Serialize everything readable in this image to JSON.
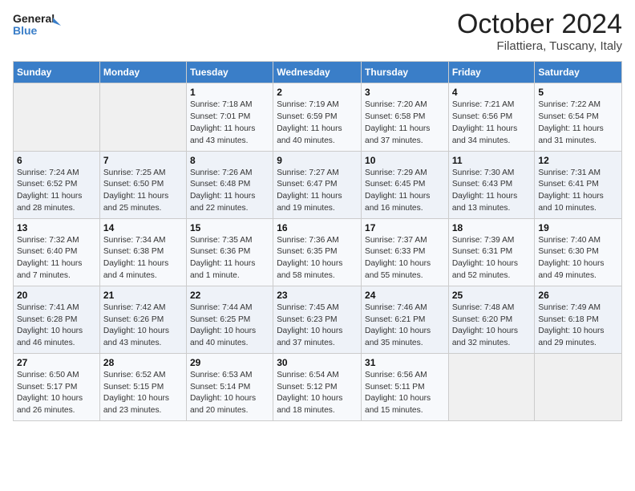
{
  "header": {
    "logo_line1": "General",
    "logo_line2": "Blue",
    "month": "October 2024",
    "location": "Filattiera, Tuscany, Italy"
  },
  "weekdays": [
    "Sunday",
    "Monday",
    "Tuesday",
    "Wednesday",
    "Thursday",
    "Friday",
    "Saturday"
  ],
  "weeks": [
    [
      {
        "num": "",
        "info": ""
      },
      {
        "num": "",
        "info": ""
      },
      {
        "num": "1",
        "info": "Sunrise: 7:18 AM\nSunset: 7:01 PM\nDaylight: 11 hours and 43 minutes."
      },
      {
        "num": "2",
        "info": "Sunrise: 7:19 AM\nSunset: 6:59 PM\nDaylight: 11 hours and 40 minutes."
      },
      {
        "num": "3",
        "info": "Sunrise: 7:20 AM\nSunset: 6:58 PM\nDaylight: 11 hours and 37 minutes."
      },
      {
        "num": "4",
        "info": "Sunrise: 7:21 AM\nSunset: 6:56 PM\nDaylight: 11 hours and 34 minutes."
      },
      {
        "num": "5",
        "info": "Sunrise: 7:22 AM\nSunset: 6:54 PM\nDaylight: 11 hours and 31 minutes."
      }
    ],
    [
      {
        "num": "6",
        "info": "Sunrise: 7:24 AM\nSunset: 6:52 PM\nDaylight: 11 hours and 28 minutes."
      },
      {
        "num": "7",
        "info": "Sunrise: 7:25 AM\nSunset: 6:50 PM\nDaylight: 11 hours and 25 minutes."
      },
      {
        "num": "8",
        "info": "Sunrise: 7:26 AM\nSunset: 6:48 PM\nDaylight: 11 hours and 22 minutes."
      },
      {
        "num": "9",
        "info": "Sunrise: 7:27 AM\nSunset: 6:47 PM\nDaylight: 11 hours and 19 minutes."
      },
      {
        "num": "10",
        "info": "Sunrise: 7:29 AM\nSunset: 6:45 PM\nDaylight: 11 hours and 16 minutes."
      },
      {
        "num": "11",
        "info": "Sunrise: 7:30 AM\nSunset: 6:43 PM\nDaylight: 11 hours and 13 minutes."
      },
      {
        "num": "12",
        "info": "Sunrise: 7:31 AM\nSunset: 6:41 PM\nDaylight: 11 hours and 10 minutes."
      }
    ],
    [
      {
        "num": "13",
        "info": "Sunrise: 7:32 AM\nSunset: 6:40 PM\nDaylight: 11 hours and 7 minutes."
      },
      {
        "num": "14",
        "info": "Sunrise: 7:34 AM\nSunset: 6:38 PM\nDaylight: 11 hours and 4 minutes."
      },
      {
        "num": "15",
        "info": "Sunrise: 7:35 AM\nSunset: 6:36 PM\nDaylight: 11 hours and 1 minute."
      },
      {
        "num": "16",
        "info": "Sunrise: 7:36 AM\nSunset: 6:35 PM\nDaylight: 10 hours and 58 minutes."
      },
      {
        "num": "17",
        "info": "Sunrise: 7:37 AM\nSunset: 6:33 PM\nDaylight: 10 hours and 55 minutes."
      },
      {
        "num": "18",
        "info": "Sunrise: 7:39 AM\nSunset: 6:31 PM\nDaylight: 10 hours and 52 minutes."
      },
      {
        "num": "19",
        "info": "Sunrise: 7:40 AM\nSunset: 6:30 PM\nDaylight: 10 hours and 49 minutes."
      }
    ],
    [
      {
        "num": "20",
        "info": "Sunrise: 7:41 AM\nSunset: 6:28 PM\nDaylight: 10 hours and 46 minutes."
      },
      {
        "num": "21",
        "info": "Sunrise: 7:42 AM\nSunset: 6:26 PM\nDaylight: 10 hours and 43 minutes."
      },
      {
        "num": "22",
        "info": "Sunrise: 7:44 AM\nSunset: 6:25 PM\nDaylight: 10 hours and 40 minutes."
      },
      {
        "num": "23",
        "info": "Sunrise: 7:45 AM\nSunset: 6:23 PM\nDaylight: 10 hours and 37 minutes."
      },
      {
        "num": "24",
        "info": "Sunrise: 7:46 AM\nSunset: 6:21 PM\nDaylight: 10 hours and 35 minutes."
      },
      {
        "num": "25",
        "info": "Sunrise: 7:48 AM\nSunset: 6:20 PM\nDaylight: 10 hours and 32 minutes."
      },
      {
        "num": "26",
        "info": "Sunrise: 7:49 AM\nSunset: 6:18 PM\nDaylight: 10 hours and 29 minutes."
      }
    ],
    [
      {
        "num": "27",
        "info": "Sunrise: 6:50 AM\nSunset: 5:17 PM\nDaylight: 10 hours and 26 minutes."
      },
      {
        "num": "28",
        "info": "Sunrise: 6:52 AM\nSunset: 5:15 PM\nDaylight: 10 hours and 23 minutes."
      },
      {
        "num": "29",
        "info": "Sunrise: 6:53 AM\nSunset: 5:14 PM\nDaylight: 10 hours and 20 minutes."
      },
      {
        "num": "30",
        "info": "Sunrise: 6:54 AM\nSunset: 5:12 PM\nDaylight: 10 hours and 18 minutes."
      },
      {
        "num": "31",
        "info": "Sunrise: 6:56 AM\nSunset: 5:11 PM\nDaylight: 10 hours and 15 minutes."
      },
      {
        "num": "",
        "info": ""
      },
      {
        "num": "",
        "info": ""
      }
    ]
  ]
}
